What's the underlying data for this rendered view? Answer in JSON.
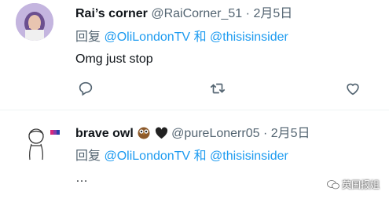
{
  "tweets": [
    {
      "name": "Rai’s corner",
      "handle": "@RaiCorner_51",
      "separator": "·",
      "date": "2月5日",
      "reply_prefix": "回复",
      "mention1": "@OliLondonTV",
      "and_word": "和",
      "mention2": "@thisisinsider",
      "text": "Omg just stop"
    },
    {
      "name": "brave owl",
      "handle": "@pureLonerr05",
      "separator": "·",
      "date": "2月5日",
      "reply_prefix": "回复",
      "mention1": "@OliLondonTV",
      "and_word": "和",
      "mention2": "@thisisinsider",
      "text": "…"
    }
  ],
  "actions": [
    "reply-icon",
    "retweet-icon",
    "like-icon",
    "share-icon"
  ],
  "watermark": "英国报姐",
  "colors": {
    "link": "#1d9bf0",
    "muted": "#536471",
    "text": "#0f1419"
  }
}
